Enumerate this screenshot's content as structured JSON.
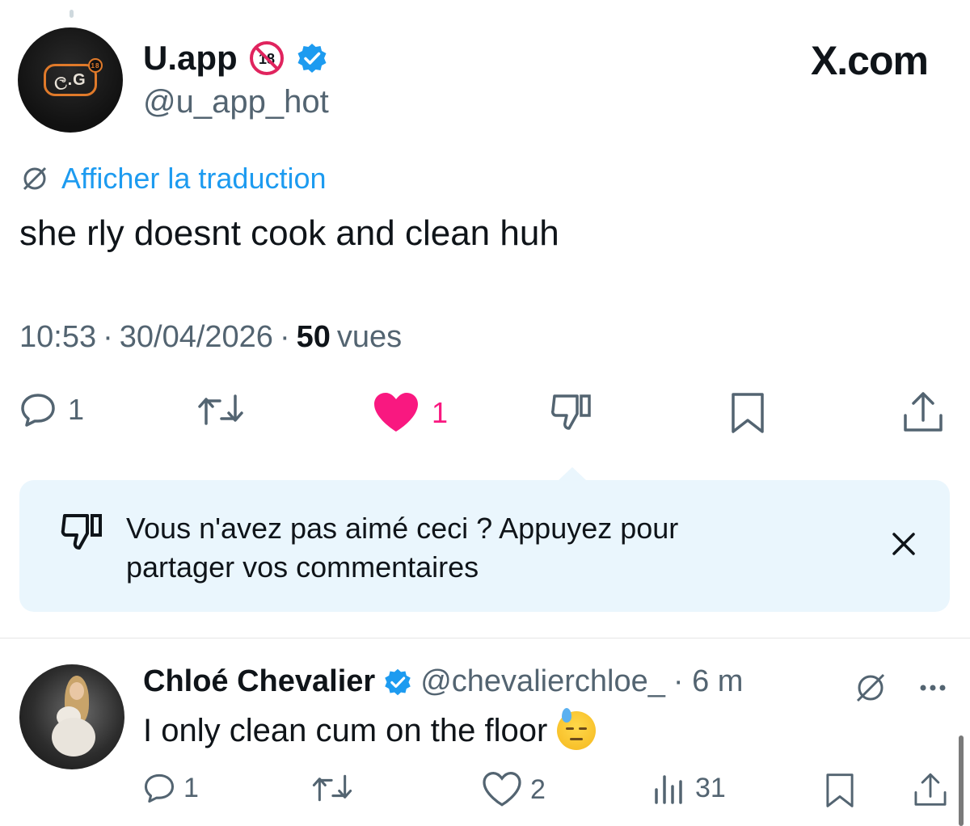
{
  "tweet": {
    "author": {
      "display_name": "U.app",
      "handle": "@u_app_hot",
      "avatar_text": "ල.G",
      "badges": [
        "no-under-18-icon",
        "verified-badge-icon"
      ]
    },
    "watermark": "X.com",
    "translate_label": "Afficher la traduction",
    "text": "she rly doesnt cook and clean huh",
    "time": "10:53",
    "date": "30/04/2026",
    "views_count": "50",
    "views_label": "vues",
    "actions": {
      "reply_count": "1",
      "retweet_count": "",
      "like_count": "1",
      "liked": true
    }
  },
  "feedback_banner": {
    "text": "Vous n'avez pas aimé ceci ? Appuyez pour partager vos commentaires"
  },
  "reply": {
    "display_name": "Chloé Chevalier",
    "handle": "@chevalierchloe_",
    "time": "· 6 m",
    "text": "I only clean cum on the floor",
    "actions": {
      "reply_count": "1",
      "like_count": "2",
      "views_count": "31"
    }
  },
  "colors": {
    "accent_blue": "#1d9bf0",
    "like_pink": "#f91880",
    "secondary_text": "#536471",
    "banner_bg": "#eaf6fd"
  }
}
